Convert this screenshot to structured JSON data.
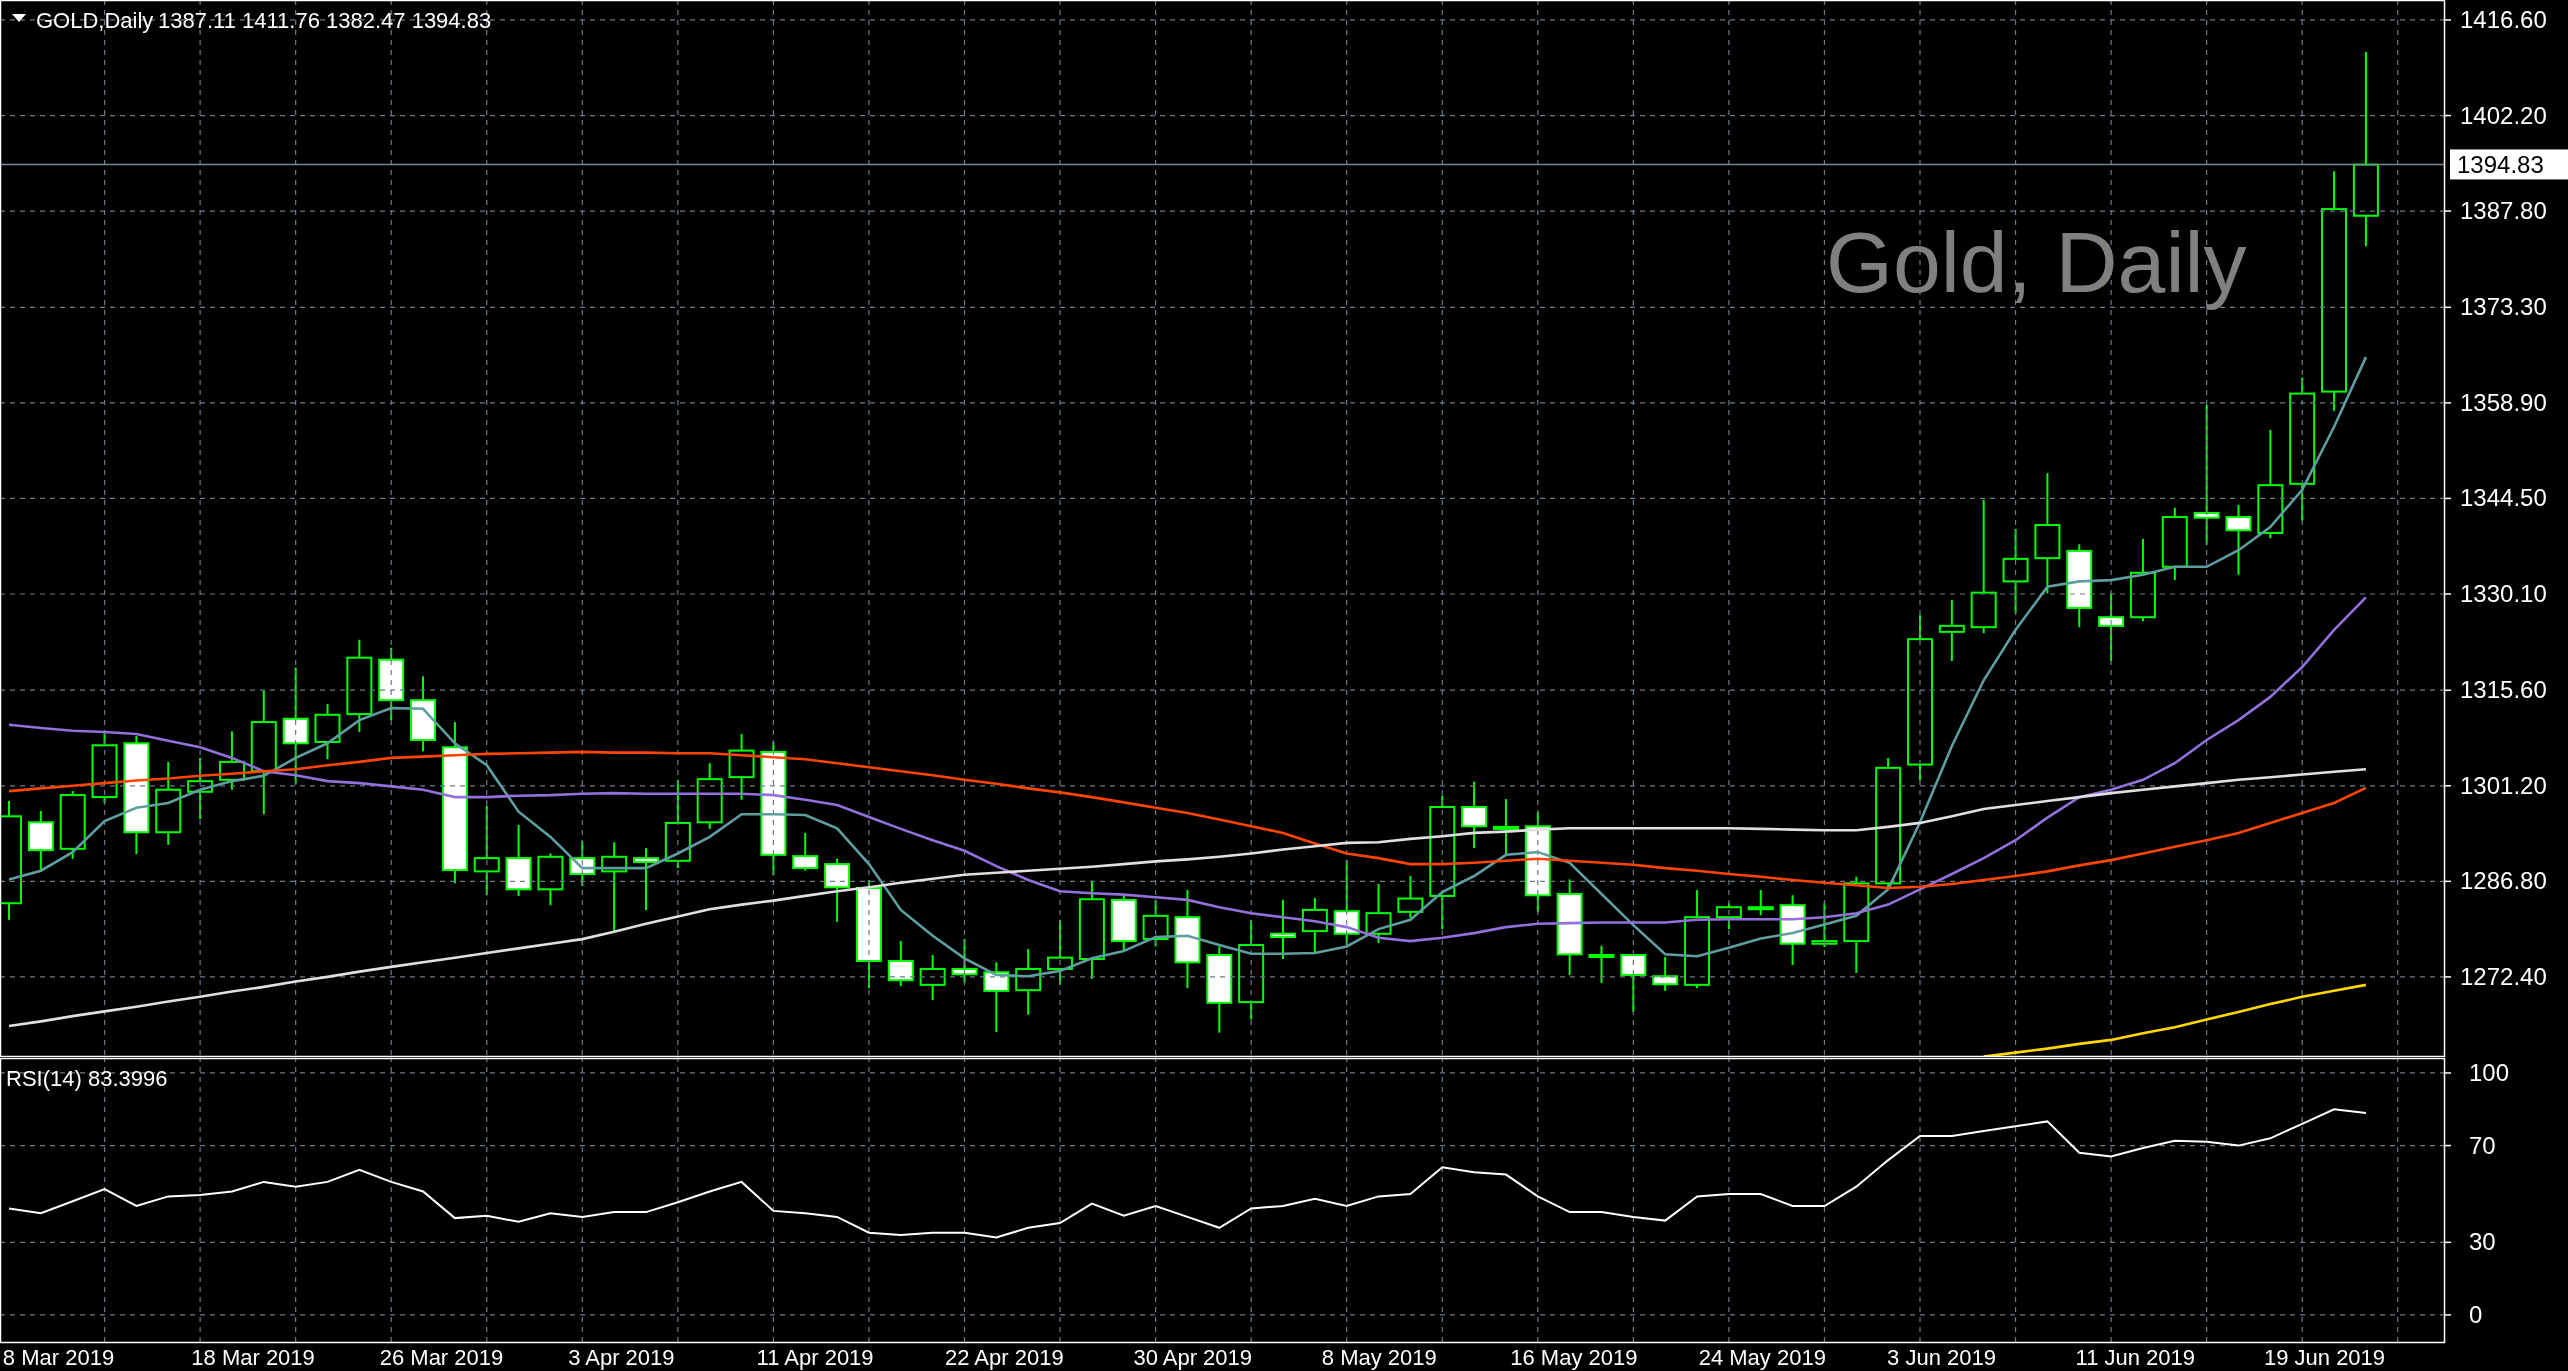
{
  "header": {
    "symbol": "GOLD,Daily",
    "quote": "1387.11 1411.76 1382.47 1394.83"
  },
  "chart_label": "Gold, Daily",
  "price_chart": {
    "chart_data": {
      "type": "line",
      "grid": true,
      "ylim": [
        1260.33,
        1419.61
      ],
      "yticks": [
        {
          "value": 1416.6,
          "label": "1416.60"
        },
        {
          "value": 1402.2,
          "label": "1402.20"
        },
        {
          "value": 1387.8,
          "label": "1387.80"
        },
        {
          "value": 1373.3,
          "label": "1373.30"
        },
        {
          "value": 1358.9,
          "label": "1358.90"
        },
        {
          "value": 1344.5,
          "label": "1344.50"
        },
        {
          "value": 1330.1,
          "label": "1330.10"
        },
        {
          "value": 1315.6,
          "label": "1315.60"
        },
        {
          "value": 1301.2,
          "label": "1301.20"
        },
        {
          "value": 1286.8,
          "label": "1286.80"
        },
        {
          "value": 1272.4,
          "label": "1272.40"
        }
      ],
      "ref_lines": [
        {
          "axis": "y",
          "value": 1394.83,
          "label": "1394.83",
          "color": "#778899"
        }
      ],
      "series": [
        {
          "color": "#5f9ea0",
          "values": [
            1287.1,
            1288.4,
            1291.2,
            1295.9,
            1297.9,
            1298.6,
            1300.6,
            1301.9,
            1302.7,
            1305.4,
            1307.6,
            1311.1,
            1312.9,
            1312.8,
            1307.6,
            1304.3,
            1297.3,
            1293.5,
            1288.8,
            1288.8,
            1288.8,
            1291.0,
            1293.5,
            1296.9,
            1296.9,
            1296.8,
            1294.8,
            1289.4,
            1282.5,
            1278.6,
            1275.2,
            1272.7,
            1272.5,
            1273.3,
            1275.2,
            1276.3,
            1278.4,
            1278.6,
            1277.2,
            1275.9,
            1275.9,
            1276.0,
            1277.0,
            1279.6,
            1281.0,
            1285.2,
            1287.6,
            1290.8,
            1291.2,
            1289.6,
            1284.9,
            1280.2,
            1275.8,
            1275.5,
            1276.8,
            1278.2,
            1279.0,
            1280.3,
            1281.6,
            1285.6,
            1295.7,
            1307.2,
            1317.1,
            1324.7,
            1331.2,
            1332.0,
            1332.2,
            1333.0,
            1334.2,
            1334.2,
            1336.7,
            1340.2,
            1345.8,
            1355.3,
            1365.8
          ]
        },
        {
          "color": "#9370db",
          "values": [
            1310.4,
            1309.9,
            1309.5,
            1309.3,
            1309.0,
            1308.0,
            1307.0,
            1305.4,
            1303.4,
            1302.8,
            1301.9,
            1301.6,
            1301.1,
            1300.6,
            1299.5,
            1299.5,
            1299.7,
            1299.8,
            1300.0,
            1300.1,
            1300.0,
            1300.0,
            1300.0,
            1300.0,
            1299.8,
            1299.1,
            1298.3,
            1296.5,
            1294.7,
            1293.0,
            1291.4,
            1289.1,
            1287.0,
            1285.3,
            1285.0,
            1284.8,
            1284.4,
            1284.0,
            1282.9,
            1282.0,
            1281.4,
            1280.8,
            1279.9,
            1278.3,
            1277.8,
            1278.3,
            1279.0,
            1279.9,
            1280.4,
            1280.5,
            1280.6,
            1280.6,
            1280.6,
            1281.0,
            1281.1,
            1281.1,
            1281.1,
            1281.4,
            1282.0,
            1283.3,
            1285.6,
            1287.9,
            1290.3,
            1293.0,
            1296.4,
            1299.5,
            1300.6,
            1302.1,
            1304.6,
            1308.1,
            1311.1,
            1314.6,
            1319.1,
            1324.7,
            1329.6
          ]
        },
        {
          "color": "#ff4500",
          "values": [
            1300.4,
            1300.8,
            1301.2,
            1301.6,
            1302.0,
            1302.3,
            1302.7,
            1303.0,
            1303.4,
            1303.7,
            1304.3,
            1304.8,
            1305.4,
            1305.6,
            1305.8,
            1306.0,
            1306.1,
            1306.2,
            1306.3,
            1306.2,
            1306.2,
            1306.1,
            1306.1,
            1305.8,
            1305.5,
            1305.2,
            1304.6,
            1304.0,
            1303.4,
            1302.8,
            1302.1,
            1301.5,
            1300.8,
            1300.2,
            1299.5,
            1298.7,
            1297.9,
            1297.1,
            1296.1,
            1295.1,
            1294.1,
            1292.5,
            1291.0,
            1290.3,
            1289.4,
            1289.4,
            1289.6,
            1289.9,
            1290.2,
            1289.9,
            1289.6,
            1289.3,
            1288.8,
            1288.4,
            1287.9,
            1287.5,
            1287.0,
            1286.6,
            1286.2,
            1285.8,
            1286.0,
            1286.4,
            1287.0,
            1287.6,
            1288.3,
            1289.2,
            1290.0,
            1291.0,
            1292.0,
            1293.0,
            1294.1,
            1295.6,
            1297.1,
            1298.6,
            1300.9
          ]
        },
        {
          "color": "#e0e0e0",
          "values": [
            1265.0,
            1265.7,
            1266.5,
            1267.2,
            1267.9,
            1268.7,
            1269.4,
            1270.2,
            1270.9,
            1271.7,
            1272.4,
            1273.2,
            1273.9,
            1274.6,
            1275.3,
            1276.0,
            1276.7,
            1277.4,
            1278.1,
            1279.2,
            1280.4,
            1281.5,
            1282.6,
            1283.3,
            1283.9,
            1284.6,
            1285.3,
            1285.9,
            1286.6,
            1287.2,
            1287.8,
            1288.1,
            1288.4,
            1288.7,
            1289.0,
            1289.4,
            1289.8,
            1290.1,
            1290.5,
            1291.0,
            1291.6,
            1292.1,
            1292.6,
            1292.7,
            1293.2,
            1293.6,
            1294.1,
            1294.3,
            1294.6,
            1294.8,
            1294.8,
            1294.8,
            1294.8,
            1294.8,
            1294.8,
            1294.7,
            1294.6,
            1294.5,
            1294.5,
            1295.0,
            1295.6,
            1296.6,
            1297.7,
            1298.3,
            1298.9,
            1299.5,
            1300.1,
            1300.6,
            1301.1,
            1301.6,
            1302.1,
            1302.5,
            1302.9,
            1303.3,
            1303.7
          ]
        },
        {
          "color": "#ffd700",
          "values": [
            null,
            null,
            null,
            null,
            null,
            null,
            null,
            null,
            null,
            null,
            null,
            null,
            null,
            null,
            null,
            null,
            null,
            null,
            null,
            null,
            null,
            null,
            null,
            null,
            null,
            null,
            null,
            null,
            null,
            null,
            null,
            null,
            null,
            null,
            null,
            null,
            null,
            null,
            null,
            null,
            null,
            null,
            null,
            null,
            null,
            null,
            null,
            null,
            null,
            null,
            null,
            null,
            null,
            null,
            null,
            null,
            null,
            null,
            null,
            null,
            null,
            null,
            1260.4,
            1261.0,
            1261.6,
            1262.3,
            1262.9,
            1263.9,
            1264.8,
            1266.0,
            1267.1,
            1268.3,
            1269.4,
            1270.3,
            1271.2
          ]
        }
      ]
    }
  },
  "rsi": {
    "chart_data": {
      "type": "line",
      "grid": true,
      "title": "RSI(14) 83.3996",
      "ylim": [
        -11.6,
        106.6
      ],
      "yticks": [
        0,
        30,
        70,
        100
      ],
      "series": [
        {
          "color": "#ffffff",
          "values": [
            44,
            42,
            47,
            52,
            45,
            49,
            49.6,
            51,
            55,
            53,
            55,
            60,
            55,
            51,
            40,
            41,
            38.5,
            42,
            40.5,
            42.5,
            42.5,
            46.6,
            51,
            55,
            43,
            42,
            40.5,
            34,
            33,
            34,
            34,
            32,
            36,
            38,
            46,
            41,
            45,
            40.5,
            36,
            44,
            45,
            48,
            45,
            49,
            50,
            61,
            59,
            58,
            49,
            42.5,
            42.5,
            40.5,
            39,
            49,
            50,
            50,
            45,
            45,
            53,
            64,
            74,
            74,
            76,
            78,
            80,
            67,
            65.5,
            69,
            72,
            71.6,
            70,
            73,
            79,
            85,
            83.4
          ]
        }
      ]
    },
    "date_labels": [
      "8 Mar 2019",
      "18 Mar 2019",
      "26 Mar 2019",
      "3 Apr 2019",
      "11 Apr 2019",
      "22 Apr 2019",
      "30 Apr 2019",
      "8 May 2019",
      "16 May 2019",
      "24 May 2019",
      "3 Jun 2019",
      "11 Jun 2019",
      "19 Jun 2019"
    ]
  }
}
